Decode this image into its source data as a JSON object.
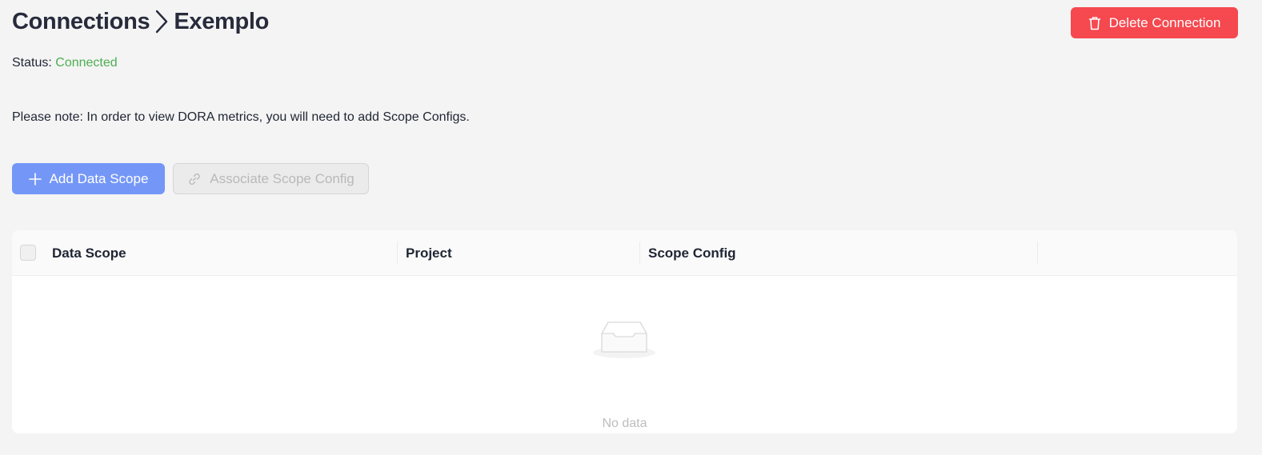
{
  "header": {
    "breadcrumb_root": "Connections",
    "breadcrumb_current": "Exemplo",
    "delete_label": "Delete Connection"
  },
  "status": {
    "label": "Status:",
    "value": "Connected",
    "value_color": "#4caf50"
  },
  "note": "Please note: In order to view DORA metrics, you will need to add Scope Configs.",
  "actions": {
    "add_label": "Add Data Scope",
    "associate_label": "Associate Scope Config"
  },
  "table": {
    "columns": [
      "Data Scope",
      "Project",
      "Scope Config",
      ""
    ],
    "rows": [],
    "empty_text": "No data"
  },
  "colors": {
    "danger": "#f5484f",
    "primary": "#7497f7",
    "success": "#4caf50"
  },
  "icons": {
    "delete": "trash-icon",
    "add": "plus-icon",
    "associate": "link-icon",
    "breadcrumb_separator": "chevron-right-icon",
    "empty": "empty-inbox-icon"
  }
}
